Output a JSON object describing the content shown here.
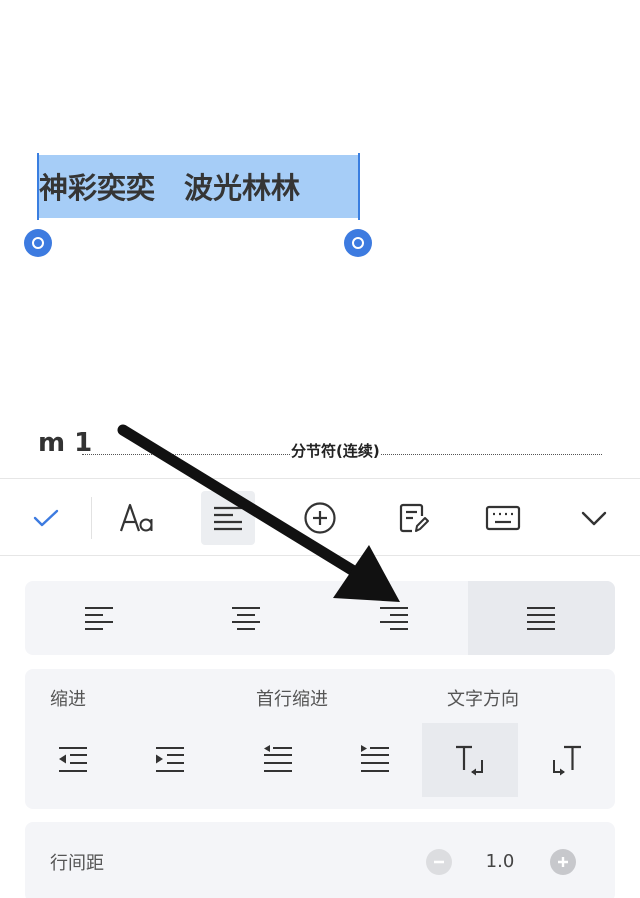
{
  "document": {
    "selected_text": "神彩奕奕　波光林林",
    "next_line_text": "m 1",
    "section_break_label": "分节符(连续)"
  },
  "toolbar": {
    "items": [
      {
        "name": "confirm",
        "icon": "check-icon"
      },
      {
        "name": "font",
        "icon": "font-aa-icon"
      },
      {
        "name": "paragraph",
        "icon": "paragraph-align-icon",
        "active": true
      },
      {
        "name": "insert",
        "icon": "plus-circle-icon"
      },
      {
        "name": "edit",
        "icon": "edit-doc-icon"
      },
      {
        "name": "keyboard",
        "icon": "keyboard-icon"
      },
      {
        "name": "collapse",
        "icon": "chevron-down-icon"
      }
    ],
    "accent_color": "#3d7be0"
  },
  "paragraph_panel": {
    "alignment": {
      "options": [
        "align-left",
        "align-center",
        "align-right",
        "align-justify"
      ],
      "selected": "align-justify"
    },
    "indent": {
      "label_indent": "缩进",
      "label_first_line": "首行缩进",
      "label_text_direction": "文字方向",
      "selected": "text-direction-horizontal"
    },
    "line_spacing": {
      "label": "行间距",
      "value": "1.0"
    }
  },
  "annotation": {
    "arrow_color": "#111111"
  }
}
